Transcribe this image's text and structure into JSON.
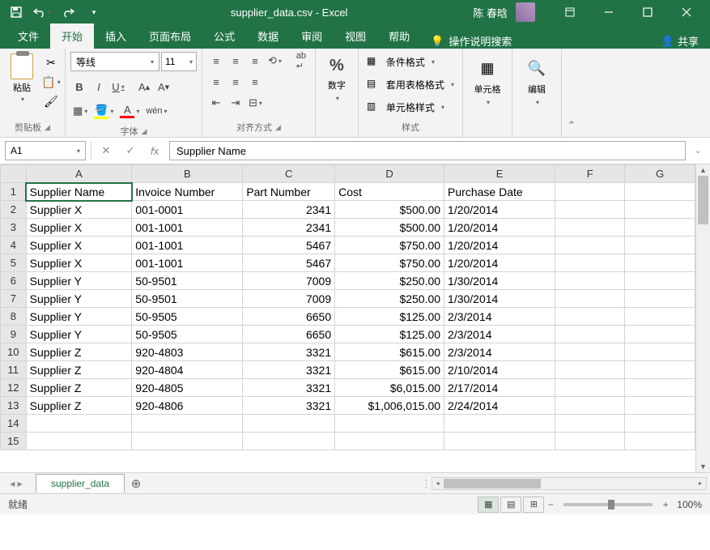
{
  "titlebar": {
    "title": "supplier_data.csv - Excel",
    "user": "陈 春晗"
  },
  "tabs": {
    "file": "文件",
    "home": "开始",
    "insert": "插入",
    "page_layout": "页面布局",
    "formulas": "公式",
    "data": "数据",
    "review": "审阅",
    "view": "视图",
    "help": "帮助",
    "tell_me": "操作说明搜索",
    "share": "共享"
  },
  "ribbon": {
    "clipboard": {
      "label": "剪贴板",
      "paste": "粘贴"
    },
    "font": {
      "label": "字体",
      "name": "等线",
      "size": "11"
    },
    "alignment": {
      "label": "对齐方式"
    },
    "number": {
      "label": "数字"
    },
    "styles": {
      "label": "样式",
      "conditional": "条件格式",
      "format_table": "套用表格格式",
      "cell_styles": "单元格样式"
    },
    "cells": {
      "label": "单元格"
    },
    "editing": {
      "label": "编辑"
    }
  },
  "formula_bar": {
    "name_box": "A1",
    "value": "Supplier Name"
  },
  "columns": [
    "A",
    "B",
    "C",
    "D",
    "E",
    "F",
    "G"
  ],
  "headers": [
    "Supplier Name",
    "Invoice Number",
    "Part Number",
    "Cost",
    "Purchase Date"
  ],
  "rows": [
    [
      "Supplier X",
      "001-0001",
      "2341",
      "$500.00",
      "1/20/2014"
    ],
    [
      "Supplier X",
      "001-1001",
      "2341",
      "$500.00",
      "1/20/2014"
    ],
    [
      "Supplier X",
      "001-1001",
      "5467",
      "$750.00",
      "1/20/2014"
    ],
    [
      "Supplier X",
      "001-1001",
      "5467",
      "$750.00",
      "1/20/2014"
    ],
    [
      "Supplier Y",
      "50-9501",
      "7009",
      "$250.00",
      "1/30/2014"
    ],
    [
      "Supplier Y",
      "50-9501",
      "7009",
      "$250.00",
      "1/30/2014"
    ],
    [
      "Supplier Y",
      "50-9505",
      "6650",
      "$125.00",
      "2/3/2014"
    ],
    [
      "Supplier Y",
      "50-9505",
      "6650",
      "$125.00",
      "2/3/2014"
    ],
    [
      "Supplier Z",
      "920-4803",
      "3321",
      "$615.00",
      "2/3/2014"
    ],
    [
      "Supplier Z",
      "920-4804",
      "3321",
      "$615.00",
      "2/10/2014"
    ],
    [
      "Supplier Z",
      "920-4805",
      "3321",
      "$6,015.00",
      "2/17/2014"
    ],
    [
      "Supplier Z",
      "920-4806",
      "3321",
      "$1,006,015.00",
      "2/24/2014"
    ]
  ],
  "sheet_tab": "supplier_data",
  "statusbar": {
    "ready": "就绪",
    "zoom": "100%"
  }
}
